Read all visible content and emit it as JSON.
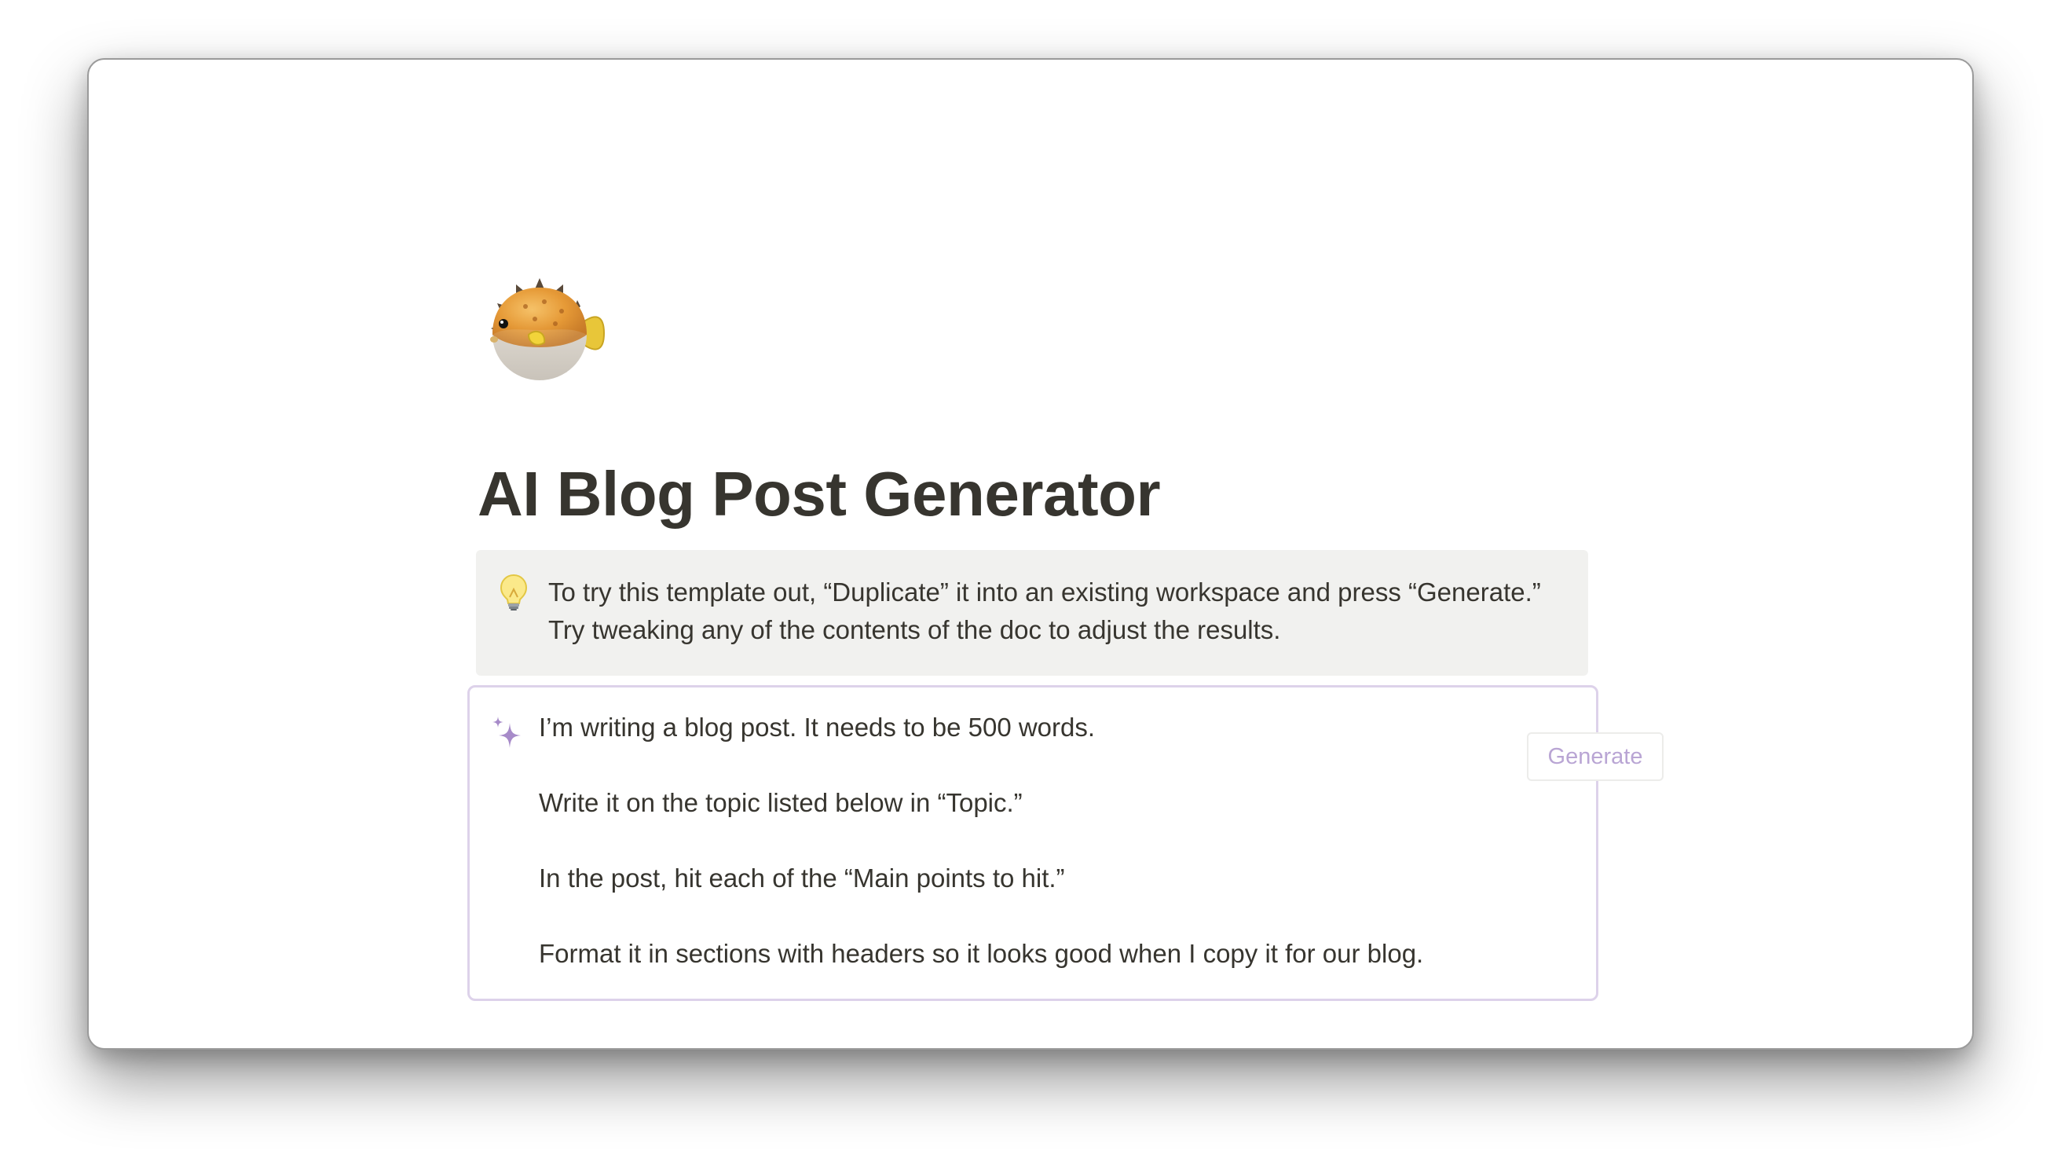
{
  "page": {
    "icon": "blowfish-icon",
    "title": "AI Blog Post Generator"
  },
  "callout": {
    "icon": "light-bulb-icon",
    "lines": [
      "To try this template out, “Duplicate” it into an existing workspace and press “Generate.”",
      "Try tweaking any of the contents of the doc to adjust the results."
    ]
  },
  "ai_block": {
    "icon": "sparkle-icon",
    "generate_label": "Generate",
    "prompt_lines": [
      "I’m writing a blog post. It needs to be 500 words.",
      "Write it on the topic listed below in “Topic.”",
      "In the post, hit each of the “Main points to hit.”",
      "Format it in sections with headers so it looks good when I copy it for our blog."
    ]
  },
  "colors": {
    "title": "#37352f",
    "callout_bg": "#f1f1ef",
    "ai_border": "#ddd2ea",
    "accent_purple": "#b9a5d4"
  }
}
